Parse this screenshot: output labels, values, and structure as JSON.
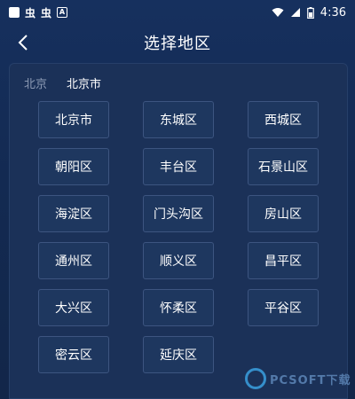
{
  "status_bar": {
    "icons": [
      "app-square-icon",
      "notification-icon",
      "notification-icon",
      "a-box-icon",
      "wifi-icon",
      "signal-icon",
      "battery-icon"
    ],
    "glyph_1": "虫",
    "glyph_2": "虫",
    "a_label": "A",
    "time": "4:36"
  },
  "header": {
    "title": "选择地区",
    "back_icon": "chevron-left-icon"
  },
  "breadcrumb": {
    "province": "北京",
    "city": "北京市"
  },
  "districts": [
    "北京市",
    "东城区",
    "西城区",
    "朝阳区",
    "丰台区",
    "石景山区",
    "海淀区",
    "门头沟区",
    "房山区",
    "通州区",
    "顺义区",
    "昌平区",
    "大兴区",
    "怀柔区",
    "平谷区",
    "密云区",
    "延庆区"
  ],
  "watermark": {
    "text": "PCSOFT下载"
  },
  "colors": {
    "background": "#16305e",
    "panel": "#1b3158",
    "button_border": "#3d5580",
    "muted_text": "#8c9ab4"
  }
}
